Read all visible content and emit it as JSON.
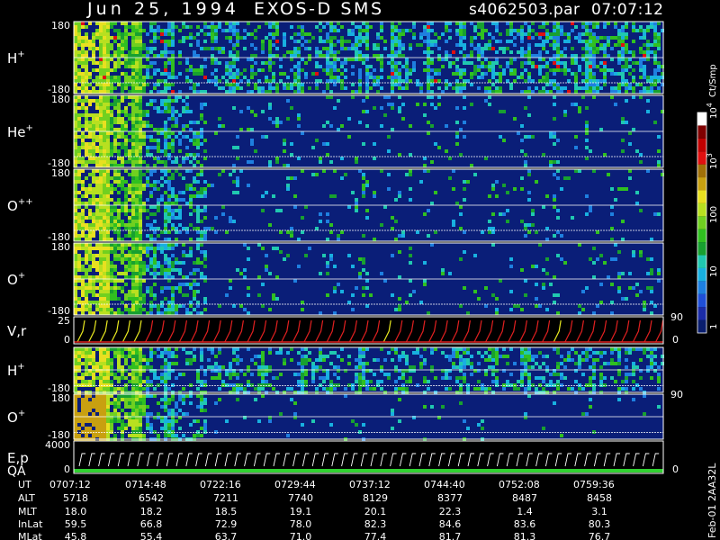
{
  "header": {
    "date": "Jun 25, 1994",
    "mission": "EXOS-D SMS",
    "file": "s4062503.par",
    "time": "07:07:12"
  },
  "colorbar": {
    "title": "Ct/Smp",
    "ticks": [
      "1",
      "10",
      "100",
      "10",
      "10"
    ],
    "tick_exponents": [
      "",
      "",
      "",
      "3",
      "4"
    ],
    "colors": [
      "#0a1e6e",
      "#1b2ca8",
      "#1f4fd8",
      "#1e7fe0",
      "#18b0e0",
      "#20c8b0",
      "#18a030",
      "#30c020",
      "#70d020",
      "#b8e020",
      "#e8e020",
      "#c8a010",
      "#a07008",
      "#e01010",
      "#c00000",
      "#800000",
      "#ffffff"
    ]
  },
  "panels": [
    {
      "id": "h-plus",
      "ion": "H",
      "charge": "+",
      "ytop": "180",
      "ybot": "-180"
    },
    {
      "id": "he-plus",
      "ion": "He",
      "charge": "+",
      "ytop": "180",
      "ybot": "-180"
    },
    {
      "id": "o-pp",
      "ion": "O",
      "charge": "++",
      "ytop": "180",
      "ybot": "-180"
    },
    {
      "id": "o-plus",
      "ion": "O",
      "charge": "+",
      "ytop": "180",
      "ybot": "-180"
    },
    {
      "id": "vr",
      "ion": "V,r",
      "charge": "",
      "ytop": "25",
      "ybot": "0",
      "rtop": "90",
      "rbot": "0"
    },
    {
      "id": "h-plus-2",
      "ion": "H",
      "charge": "+",
      "ytop": "",
      "ybot": "-180"
    },
    {
      "id": "o-plus-2",
      "ion": "O",
      "charge": "+",
      "ytop": "180",
      "ybot": "-180",
      "rtop": "90"
    },
    {
      "id": "ep",
      "ion": "E,p",
      "sub": "QA",
      "charge": "",
      "ytop": "4000",
      "ybot": "0",
      "rbot": "0"
    }
  ],
  "footer": {
    "row_labels": [
      "UT",
      "ALT",
      "MLT",
      "InLat",
      "MLat"
    ],
    "columns": [
      {
        "ut": "0707:12",
        "alt": "5718",
        "mlt": "18.0",
        "inlat": "59.5",
        "mlat": "45.8"
      },
      {
        "ut": "0714:48",
        "alt": "6542",
        "mlt": "18.2",
        "inlat": "66.8",
        "mlat": "55.4"
      },
      {
        "ut": "0722:16",
        "alt": "7211",
        "mlt": "18.5",
        "inlat": "72.9",
        "mlat": "63.7"
      },
      {
        "ut": "0729:44",
        "alt": "7740",
        "mlt": "19.1",
        "inlat": "78.0",
        "mlat": "71.0"
      },
      {
        "ut": "0737:12",
        "alt": "8129",
        "mlt": "20.1",
        "inlat": "82.3",
        "mlat": "77.4"
      },
      {
        "ut": "0744:40",
        "alt": "8377",
        "mlt": "22.3",
        "inlat": "84.6",
        "mlat": "81.7"
      },
      {
        "ut": "0752:08",
        "alt": "8487",
        "mlt": "1.4",
        "inlat": "83.6",
        "mlat": "81.3"
      },
      {
        "ut": "0759:36",
        "alt": "8458",
        "mlt": "3.1",
        "inlat": "80.3",
        "mlat": "76.7"
      }
    ],
    "side_label": "Feb-01 2AA32L"
  },
  "chart_data": {
    "type": "heatmap",
    "title": "Jun 25, 1994   EXOS-D SMS",
    "xlabel": "UT",
    "x_ticks": [
      "0707:12",
      "0714:48",
      "0722:16",
      "0729:44",
      "0737:12",
      "0744:40",
      "0752:08",
      "0759:36"
    ],
    "series": [
      {
        "name": "H+",
        "ylim": [
          -180,
          180
        ]
      },
      {
        "name": "He+",
        "ylim": [
          -180,
          180
        ]
      },
      {
        "name": "O++",
        "ylim": [
          -180,
          180
        ]
      },
      {
        "name": "O+",
        "ylim": [
          -180,
          180
        ]
      },
      {
        "name": "V,r",
        "ylim": [
          0,
          25
        ]
      },
      {
        "name": "H+",
        "ylim": [
          -180,
          180
        ]
      },
      {
        "name": "O+",
        "ylim": [
          -180,
          180
        ]
      },
      {
        "name": "E,p",
        "ylim": [
          0,
          4000
        ]
      }
    ],
    "colorscale_label": "Ct/Smp",
    "colorscale_range": [
      1,
      10000
    ],
    "colorscale_log": true
  }
}
